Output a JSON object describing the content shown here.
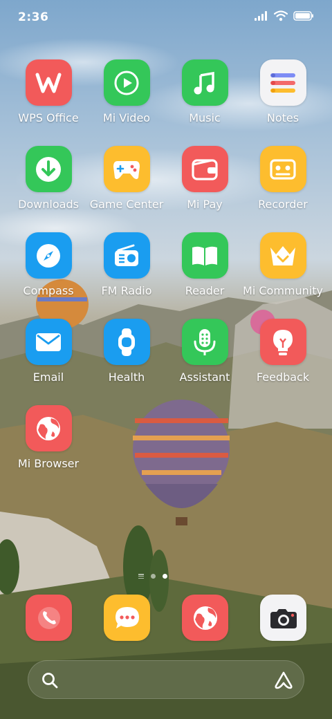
{
  "status": {
    "time": "2:36"
  },
  "apps": [
    {
      "label": "WPS Office",
      "icon": "wps-office-icon",
      "color": "#f25a5a"
    },
    {
      "label": "Mi Video",
      "icon": "mi-video-icon",
      "color": "#34c759"
    },
    {
      "label": "Music",
      "icon": "music-icon",
      "color": "#34c759"
    },
    {
      "label": "Notes",
      "icon": "notes-icon",
      "color": "#f3f3f5"
    },
    {
      "label": "Downloads",
      "icon": "downloads-icon",
      "color": "#34c759"
    },
    {
      "label": "Game Center",
      "icon": "game-center-icon",
      "color": "#fdbd2e"
    },
    {
      "label": "Mi Pay",
      "icon": "mi-pay-icon",
      "color": "#f25a5a"
    },
    {
      "label": "Recorder",
      "icon": "recorder-icon",
      "color": "#fdbd2e"
    },
    {
      "label": "Compass",
      "icon": "compass-icon",
      "color": "#1a9df0"
    },
    {
      "label": "FM Radio",
      "icon": "fm-radio-icon",
      "color": "#1a9df0"
    },
    {
      "label": "Reader",
      "icon": "reader-icon",
      "color": "#34c759"
    },
    {
      "label": "Mi Community",
      "icon": "mi-community-icon",
      "color": "#fdbd2e"
    },
    {
      "label": "Email",
      "icon": "email-icon",
      "color": "#1a9df0"
    },
    {
      "label": "Health",
      "icon": "health-icon",
      "color": "#1a9df0"
    },
    {
      "label": "Assistant",
      "icon": "assistant-icon",
      "color": "#34c759"
    },
    {
      "label": "Feedback",
      "icon": "feedback-icon",
      "color": "#f25a5a"
    },
    {
      "label": "Mi Browser",
      "icon": "mi-browser-icon",
      "color": "#f25a5a"
    }
  ],
  "dock": [
    {
      "icon": "phone-icon",
      "color": "#f25a5a"
    },
    {
      "icon": "messaging-icon",
      "color": "#fdbd2e"
    },
    {
      "icon": "browser-icon",
      "color": "#f25a5a"
    },
    {
      "icon": "camera-icon",
      "color": "#f3f3f5"
    }
  ],
  "pages": {
    "count": 2,
    "active": 1
  }
}
